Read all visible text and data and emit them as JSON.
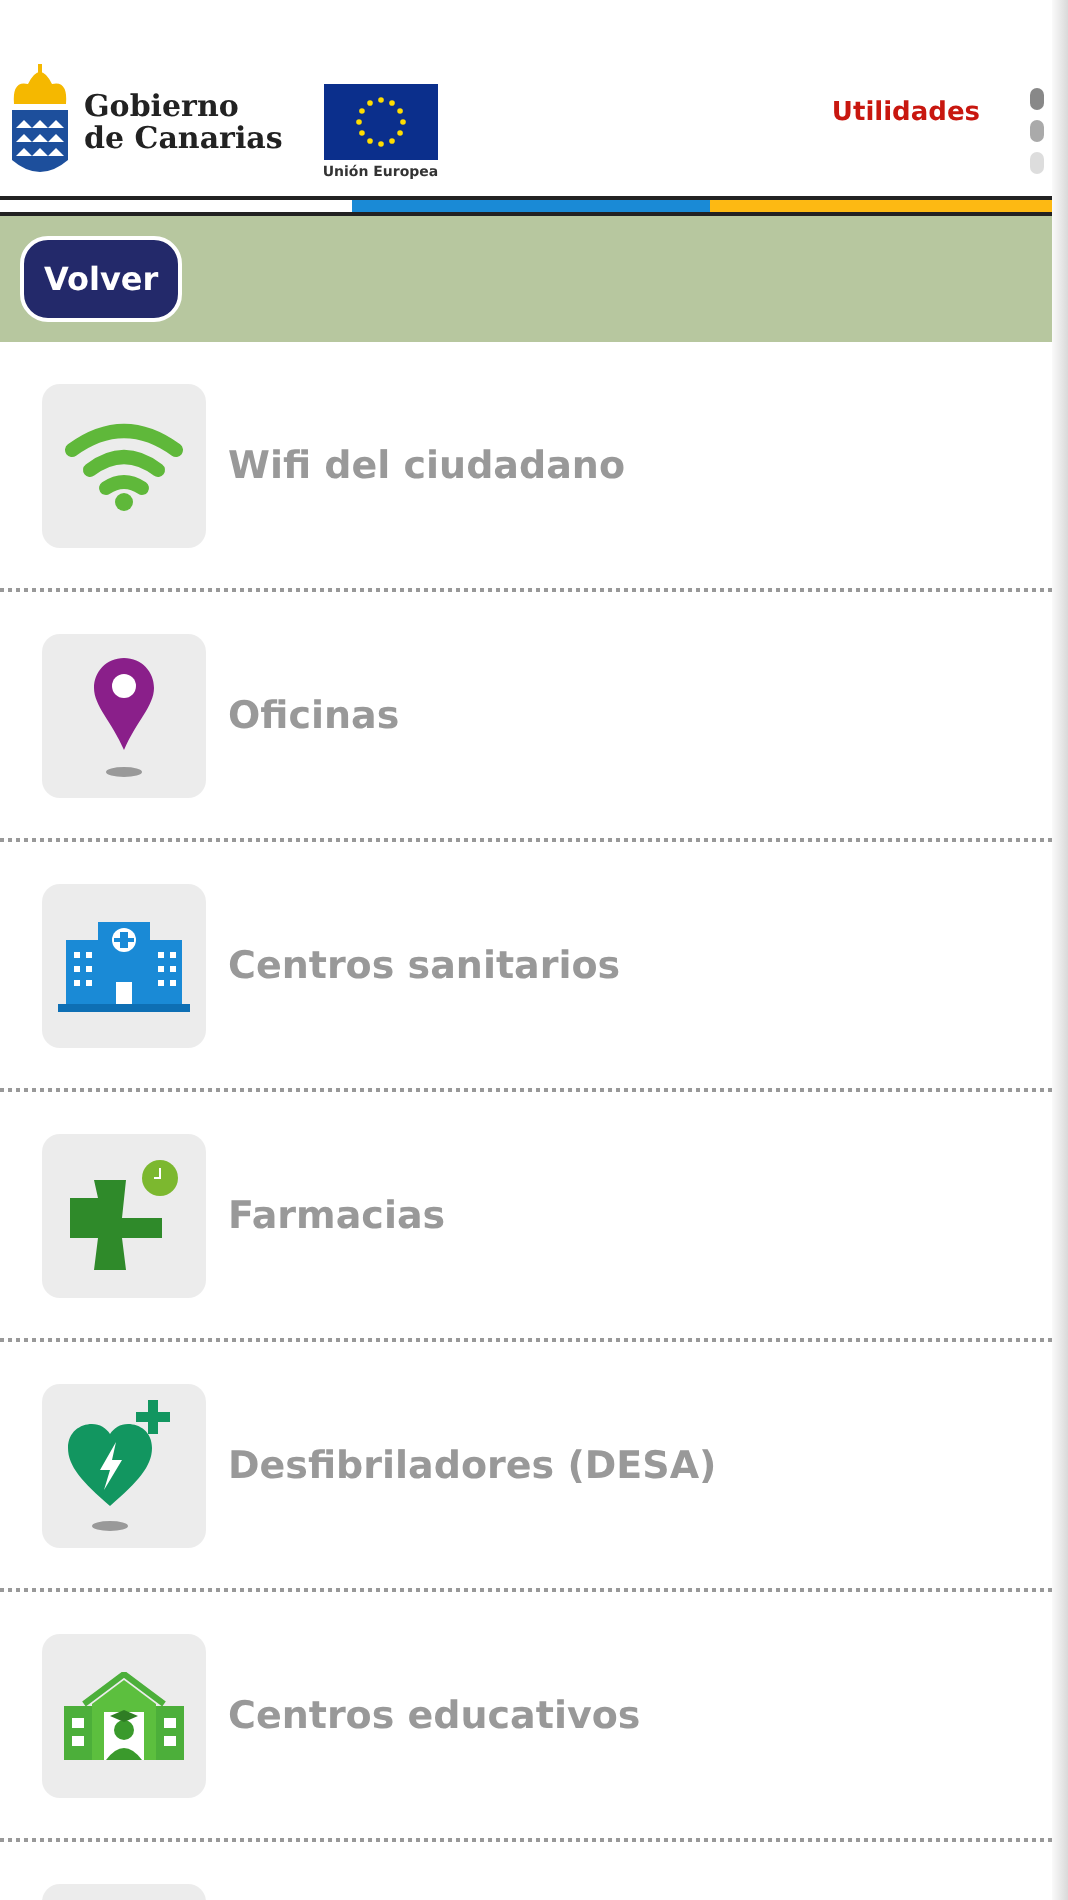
{
  "header": {
    "logo_line_1": "Gobierno",
    "logo_line_2": "de Canarias",
    "eu_caption": "Unión Europea",
    "menu_link": "Utilidades"
  },
  "toolbar": {
    "back_button": "Volver"
  },
  "items": [
    {
      "kind": "wifi",
      "label": "Wifi del ciudadano"
    },
    {
      "kind": "pin",
      "label": "Oficinas"
    },
    {
      "kind": "hospital",
      "label": "Centros sanitarios"
    },
    {
      "kind": "pharmacy",
      "label": "Farmacias"
    },
    {
      "kind": "defibrillator",
      "label": "Desfibriladores (DESA)"
    },
    {
      "kind": "school",
      "label": "Centros educativos"
    }
  ]
}
